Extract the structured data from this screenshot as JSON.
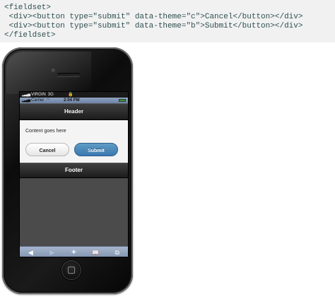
{
  "code": {
    "lines": [
      "<fieldset>",
      " <div><button type=\"submit\" data-theme=\"c\">Cancel</button></div>",
      " <div><button type=\"submit\" data-theme=\"b\">Submit</button></div>",
      "</fieldset>"
    ]
  },
  "status_bar": {
    "carrier_top": "VIRGIN",
    "network": "3G",
    "lock_icon": "lock-icon"
  },
  "safari_status": {
    "carrier": "Carrier",
    "time": "2:04 PM",
    "wifi_icon": "wifi-icon",
    "battery_icon": "battery-icon"
  },
  "header": {
    "title": "Header"
  },
  "content": {
    "text": "Content goes here",
    "cancel_label": "Cancel",
    "submit_label": "Submit"
  },
  "footer": {
    "title": "Footer"
  },
  "toolbar": {
    "back": "◀",
    "forward": "▶",
    "add": "+",
    "bookmarks": "📖",
    "pages": "⧉"
  },
  "colors": {
    "submit_button": "#3a78b0",
    "header_bar": "#1c1c1c",
    "toolbar": "#7d90ad"
  }
}
